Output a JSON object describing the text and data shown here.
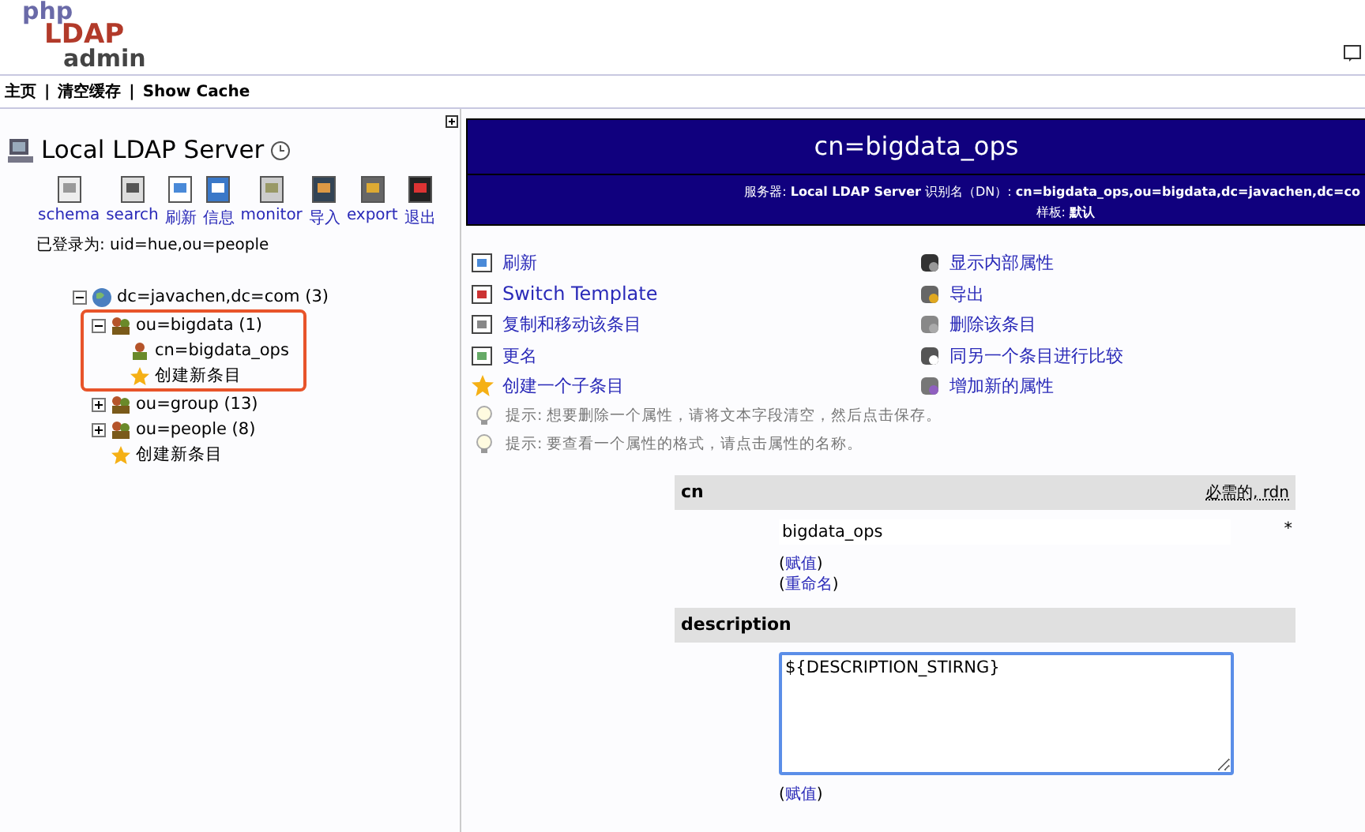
{
  "logo": {
    "parts": [
      "php",
      "LDAP",
      "admin"
    ]
  },
  "nav": {
    "items": [
      "主页",
      "清空缓存",
      "Show Cache"
    ],
    "separator": "|"
  },
  "server": {
    "name": "Local LDAP Server",
    "toolbar": [
      "schema",
      "search",
      "刷新",
      "信息",
      "monitor",
      "导入",
      "export",
      "退出"
    ],
    "logged_in": "已登录为: uid=hue,ou=people"
  },
  "tree": [
    {
      "label": "dc=javachen,dc=com (3)",
      "kind": "domain",
      "expanded": true,
      "children": [
        {
          "label": "ou=bigdata (1)",
          "kind": "ou",
          "expanded": true,
          "highlighted": true,
          "children": [
            {
              "label": "cn=bigdata_ops",
              "kind": "entry"
            },
            {
              "label": "创建新条目",
              "kind": "create"
            }
          ]
        },
        {
          "label": "ou=group (13)",
          "kind": "ou",
          "expanded": false
        },
        {
          "label": "ou=people (8)",
          "kind": "ou",
          "expanded": false
        },
        {
          "label": "创建新条目",
          "kind": "create"
        }
      ]
    }
  ],
  "entry": {
    "title": "cn=bigdata_ops",
    "info_line": "服务器: **Local LDAP Server**   识别名（DN）: **cn=bigdata_ops,ou=bigdata,dc=javachen,dc=co**",
    "template_line": "样板: **默认**",
    "actions_left": [
      "刷新",
      "Switch Template",
      "复制和移动该条目",
      "更名",
      "创建一个子条目"
    ],
    "actions_right": [
      "显示内部属性",
      "导出",
      "删除该条目",
      "同另一个条目进行比较",
      "增加新的属性"
    ],
    "hints": [
      "提示:   想要删除一个属性，请将文本字段清空，然后点击保存。",
      "提示:   要查看一个属性的格式，请点击属性的名称。"
    ],
    "attributes": [
      {
        "name": "cn",
        "kind": "input",
        "note": "必需的, rdn",
        "value": "bigdata_ops",
        "mark": "*",
        "links": [
          {
            "open": "(",
            "label": "赋值",
            "close": ")"
          },
          {
            "open": "(",
            "label": "重命名",
            "close": ")"
          }
        ]
      },
      {
        "name": "description",
        "kind": "textarea",
        "value": "${DESCRIPTION_STIRNG}",
        "links": [
          {
            "open": "(",
            "label": "赋值",
            "close": ")"
          }
        ]
      }
    ]
  }
}
